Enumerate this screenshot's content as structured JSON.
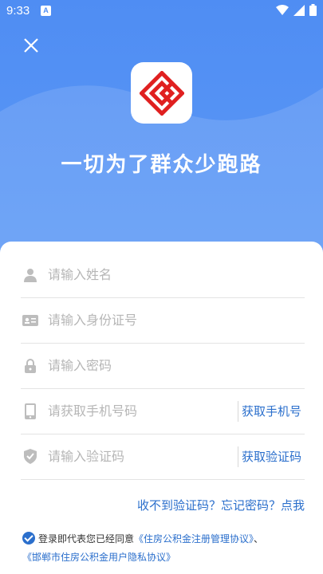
{
  "status_bar": {
    "time": "9:33",
    "notification_badge": "A"
  },
  "header": {
    "slogan": "一切为了群众少跑路"
  },
  "form": {
    "name_placeholder": "请输入姓名",
    "id_placeholder": "请输入身份证号",
    "password_placeholder": "请输入密码",
    "phone_placeholder": "请获取手机号码",
    "get_phone_label": "获取手机号",
    "code_placeholder": "请输入验证码",
    "get_code_label": "获取验证码"
  },
  "help": {
    "no_code": "收不到验证码？",
    "forgot_password": "忘记密码？",
    "click_me": "点我"
  },
  "agreement": {
    "prefix": "登录即代表您已经同意",
    "link1": "《住房公积金注册管理协议》",
    "separator": "、",
    "link2": "《邯郸市住房公积金用户隐私协议》"
  },
  "colors": {
    "accent": "#2b6fcc",
    "header_bg": "#4f8df3",
    "logo_red": "#e02020"
  }
}
